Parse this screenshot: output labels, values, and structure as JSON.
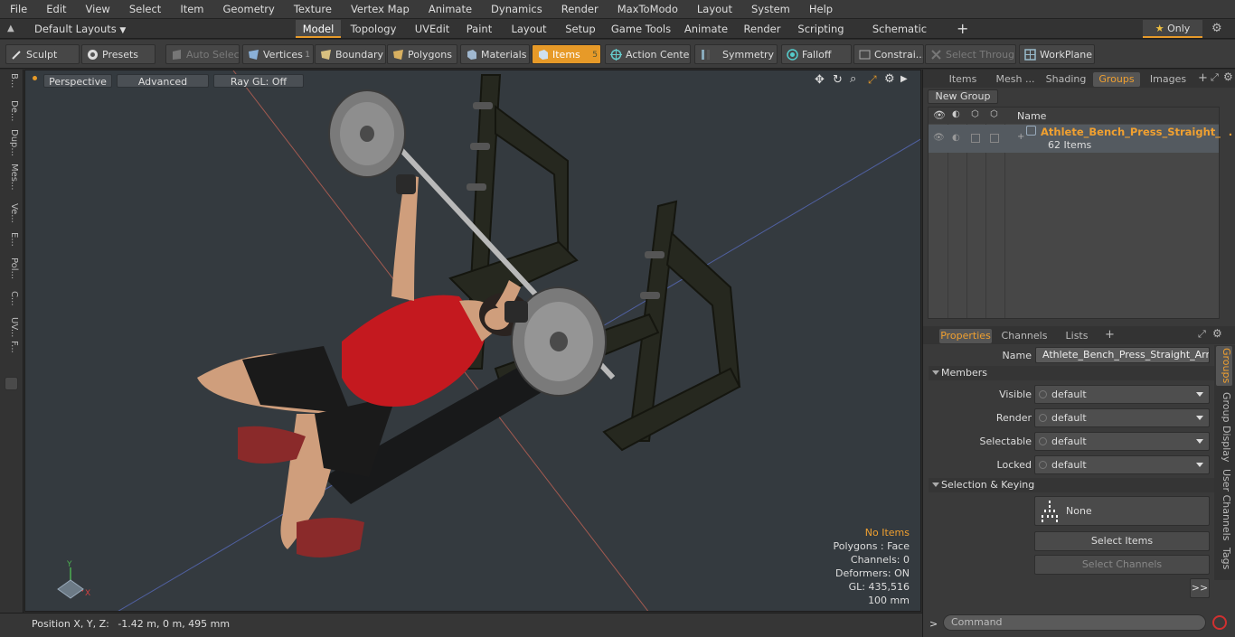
{
  "menu": [
    "File",
    "Edit",
    "View",
    "Select",
    "Item",
    "Geometry",
    "Texture",
    "Vertex Map",
    "Animate",
    "Dynamics",
    "Render",
    "MaxToModo",
    "Layout",
    "System",
    "Help"
  ],
  "modebar": {
    "layouts": "Default Layouts",
    "tabs": [
      "Model",
      "Topology",
      "UVEdit",
      "Paint",
      "Layout",
      "Setup",
      "Game Tools",
      "Animate",
      "Render",
      "Scripting",
      "Schematic Fusion"
    ],
    "active_tab": "Model",
    "only": "Only"
  },
  "toolbar": {
    "sculpt": "Sculpt",
    "presets": "Presets",
    "auto_select": "Auto Select",
    "vertices": "Vertices",
    "vertices_count": "1",
    "boundary": "Boundary",
    "polygons": "Polygons",
    "materials": "Materials",
    "items": "Items",
    "items_count": "5",
    "action_center": "Action Center",
    "symmetry": "Symmetry",
    "falloff": "Falloff",
    "constraints": "Constrai...",
    "select_through": "Select Through",
    "workplane": "WorkPlane"
  },
  "left_tabs": [
    "B...",
    "De...",
    "Dup...",
    "Mes...",
    "Ve...",
    "E...",
    "Pol...",
    "C...",
    "UV...",
    "F..."
  ],
  "viewport": {
    "perspective": "Perspective",
    "advanced": "Advanced",
    "raygl": "Ray GL: Off",
    "stats": {
      "items": "No Items",
      "polygons": "Polygons : Face",
      "channels": "Channels: 0",
      "deformers": "Deformers: ON",
      "gl": "GL: 435,516",
      "scale": "100 mm"
    },
    "axis_y": "Y",
    "axis_x": "X"
  },
  "status": {
    "position_label": "Position X, Y, Z:",
    "position_value": "-1.42 m, 0 m, 495 mm"
  },
  "top_panel": {
    "tabs": [
      "Items",
      "Mesh ...",
      "Shading",
      "Groups",
      "Images"
    ],
    "active_tab": "Groups",
    "new_group": "New Group",
    "col_name": "Name",
    "group_name": "Athlete_Bench_Press_Straight_...",
    "group_count": "62 Items"
  },
  "properties": {
    "tabs": [
      "Properties",
      "Channels",
      "Lists"
    ],
    "active_tab": "Properties",
    "name_label": "Name",
    "name_value": "Athlete_Bench_Press_Straight_Arms_",
    "members_header": "Members",
    "fields": [
      {
        "label": "Visible",
        "value": "default"
      },
      {
        "label": "Render",
        "value": "default"
      },
      {
        "label": "Selectable",
        "value": "default"
      },
      {
        "label": "Locked",
        "value": "default"
      }
    ],
    "selection_header": "Selection & Keying",
    "none_label": "None",
    "select_items": "Select Items",
    "select_channels": "Select Channels",
    "more": ">>",
    "side_tabs": [
      "Groups",
      "Group Display",
      "User Channels",
      "Tags"
    ]
  },
  "command": {
    "prompt": ">",
    "placeholder": "Command"
  },
  "colors": {
    "accent": "#e79a28",
    "group_name": "#f0a030"
  }
}
